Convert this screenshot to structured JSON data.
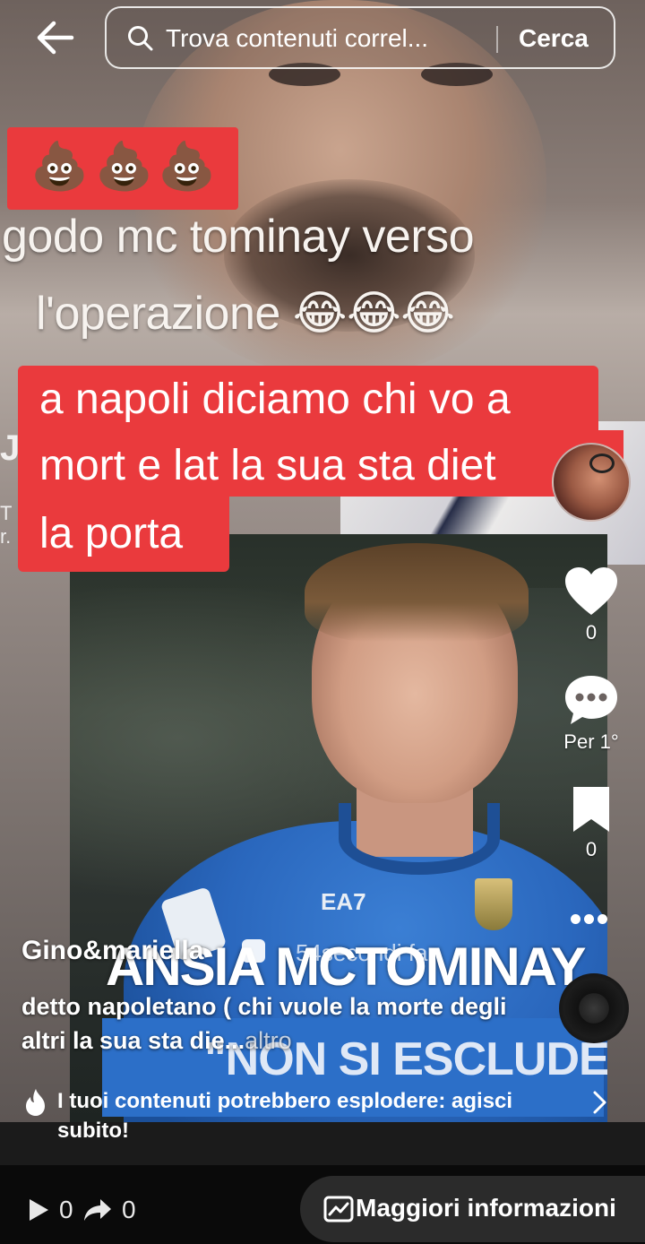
{
  "search": {
    "placeholder": "Trova contenuti correl...",
    "button": "Cerca"
  },
  "overlay": {
    "emojis": [
      "💩",
      "💩",
      "💩"
    ],
    "caption_line1": "godo mc tominay  verso",
    "caption_line2": "l'operazione 😂😂😂",
    "red_line1": "a napoli diciamo chi vo a",
    "red_line2": "mort e lat la sua sta diet",
    "red_line3": "la porta"
  },
  "inset": {
    "headline": "ANSIA MCTOMINAY",
    "subline": "\"NON SI ESCLUDE",
    "jersey_brand": "EA7"
  },
  "rail": {
    "likes": "0",
    "comments": "Per 1°",
    "saves": "0"
  },
  "post": {
    "author": "Gino&mariella",
    "time": "54secondi fa",
    "description": "detto napoletano ( chi vuole la morte degli altri la sua sta die...",
    "more": "altro"
  },
  "promo": {
    "text": "I tuoi contenuti potrebbero esplodere: agisci subito!"
  },
  "bottom": {
    "views": "0",
    "shares": "0",
    "info_button": "Maggiori informazioni"
  },
  "colors": {
    "caption_red": "#ea3a3d",
    "bottom_bg": "#0a0a0a",
    "button_bg": "#2b2b2b"
  }
}
